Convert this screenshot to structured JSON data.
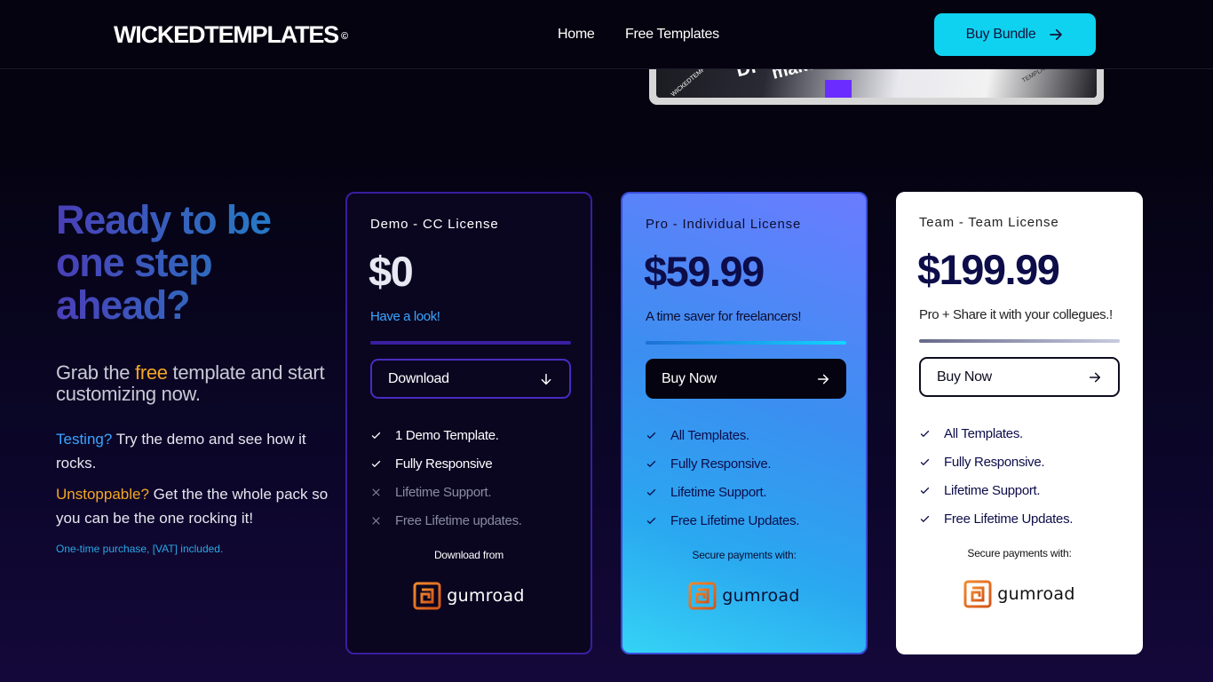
{
  "nav": {
    "logo": "WICKEDTEMPLATES",
    "logo_mark": "©",
    "links": [
      "Home",
      "Free Templates"
    ],
    "cta": "Buy Bundle"
  },
  "preview": {
    "lines": [
      "Di",
      "make",
      "WICKEDTEMPLATES",
      "TEMPLATES"
    ]
  },
  "hero": {
    "headline": "Ready to be one step ahead?",
    "sub_before": "Grab the ",
    "sub_free": "free",
    "sub_after": " template and start customizing now.",
    "testing_key": "Testing?",
    "testing_text": " Try the demo and see how it rocks.",
    "unstoppable_key": "Unstoppable?",
    "unstoppable_text": " Get the the whole pack so you can be the one rocking it!",
    "vat_note": "One-time purchase, [VAT] included."
  },
  "plans": [
    {
      "title": "Demo - CC License",
      "price": "$0",
      "tagline": "Have a look!",
      "button": "Download",
      "button_icon": "arrow-down-icon",
      "features": [
        {
          "label": "1 Demo Template.",
          "included": true
        },
        {
          "label": "Fully Responsive",
          "included": true
        },
        {
          "label": "Lifetime Support.",
          "included": false
        },
        {
          "label": "Free Lifetime updates.",
          "included": false
        }
      ],
      "pay_label": "Download from",
      "pay_brand": "gumroad"
    },
    {
      "title": "Pro - Individual License",
      "price": "$59.99",
      "tagline": "A time saver for freelancers!",
      "button": "Buy Now",
      "button_icon": "arrow-right-icon",
      "features": [
        {
          "label": "All Templates.",
          "included": true
        },
        {
          "label": "Fully Responsive.",
          "included": true
        },
        {
          "label": "Lifetime Support.",
          "included": true
        },
        {
          "label": "Free Lifetime Updates.",
          "included": true
        }
      ],
      "pay_label": "Secure payments with:",
      "pay_brand": "gumroad"
    },
    {
      "title": "Team - Team License",
      "price": "$199.99",
      "tagline": "Pro + Share it with your collegues.!",
      "button": "Buy Now",
      "button_icon": "arrow-right-icon",
      "features": [
        {
          "label": "All Templates.",
          "included": true
        },
        {
          "label": "Fully Responsive.",
          "included": true
        },
        {
          "label": "Lifetime Support.",
          "included": true
        },
        {
          "label": "Free Lifetime Updates.",
          "included": true
        }
      ],
      "pay_label": "Secure payments with:",
      "pay_brand": "gumroad"
    }
  ],
  "colors": {
    "accent_cyan": "#0fd2f0",
    "accent_orange": "#f5a623",
    "link_blue": "#3aa5ff",
    "background": "#05030f"
  }
}
